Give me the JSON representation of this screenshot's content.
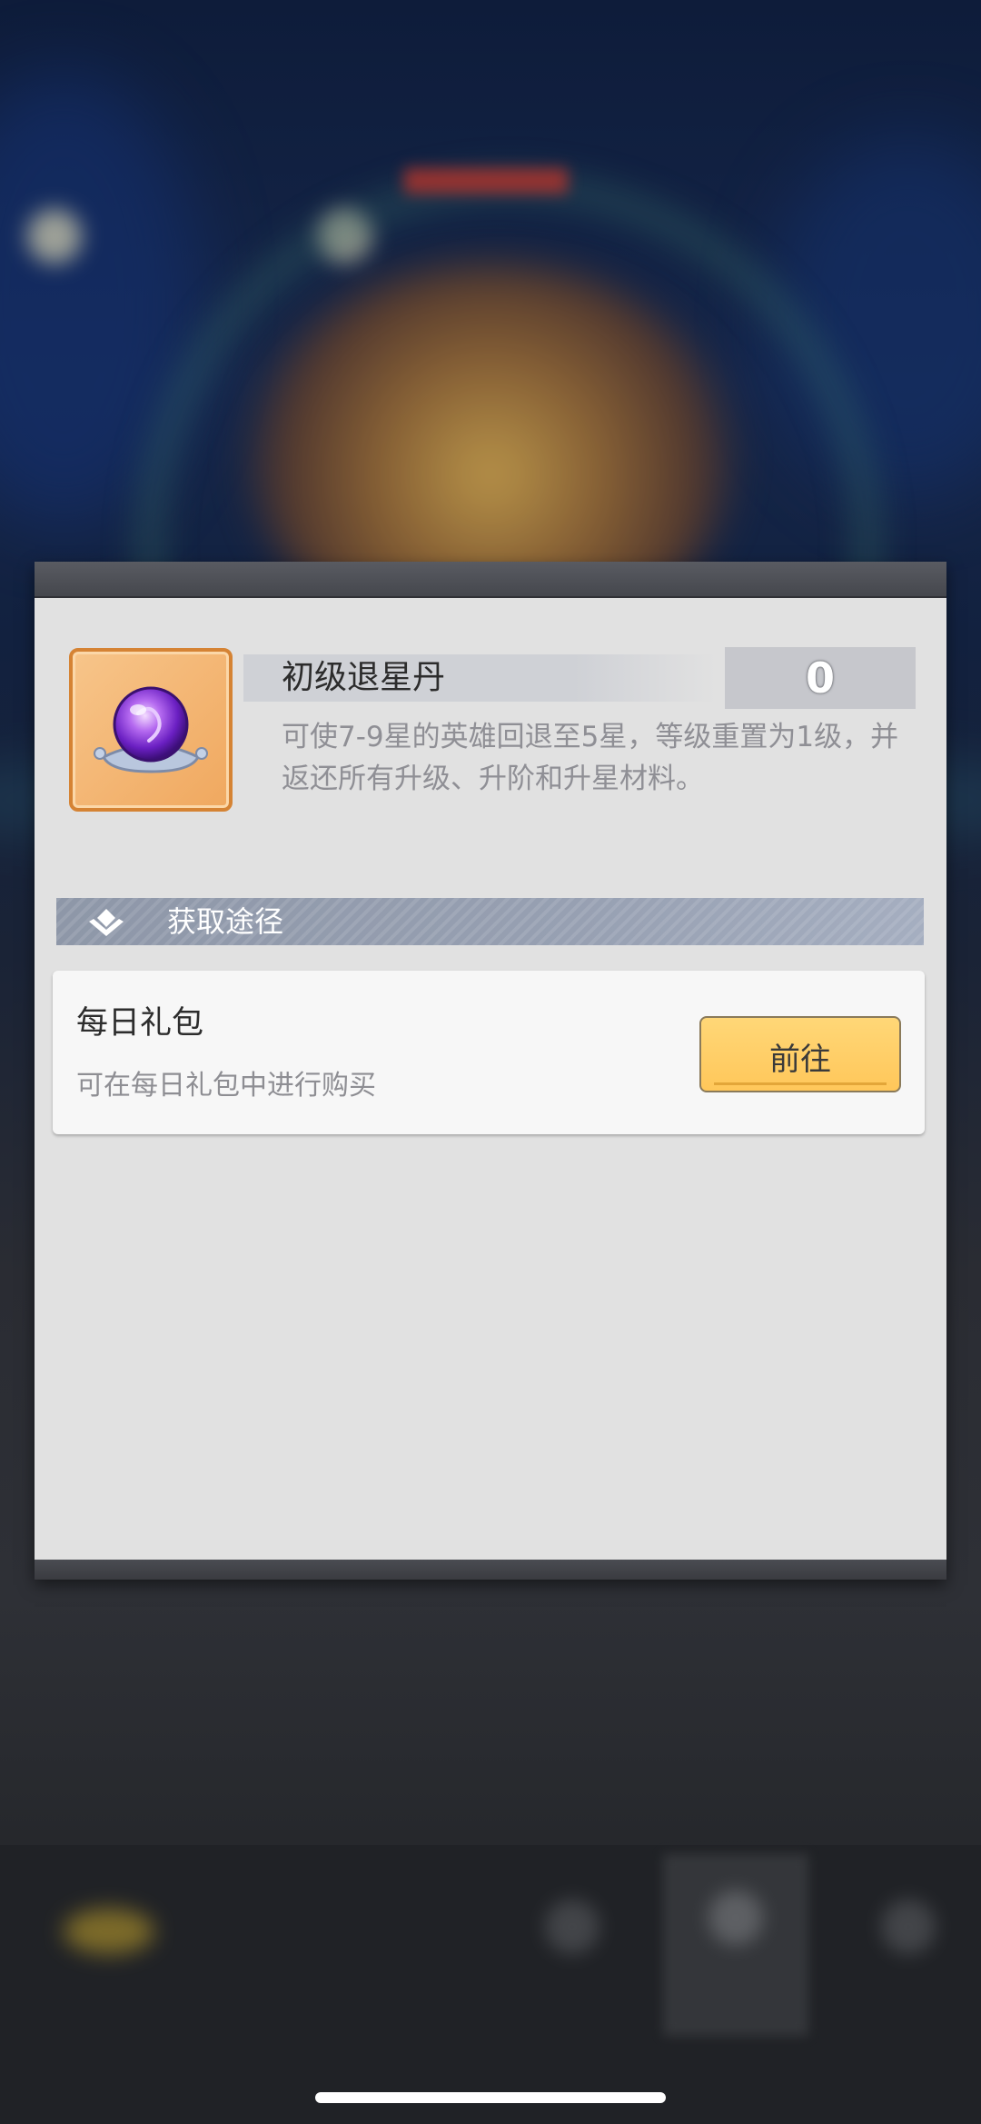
{
  "item": {
    "name": "初级退星丹",
    "count": "0",
    "description": "可使7-9星的英雄回退至5星，等级重置为1级，并返还所有升级、升阶和升星材料。"
  },
  "section": {
    "title": "获取途径"
  },
  "sources": [
    {
      "title": "每日礼包",
      "description": "可在每日礼包中进行购买",
      "button_label": "前往"
    }
  ],
  "colors": {
    "dialog_bg": "#e1e1e1",
    "button_bg": "#ffd06a",
    "section_header": "#97a0b2"
  }
}
